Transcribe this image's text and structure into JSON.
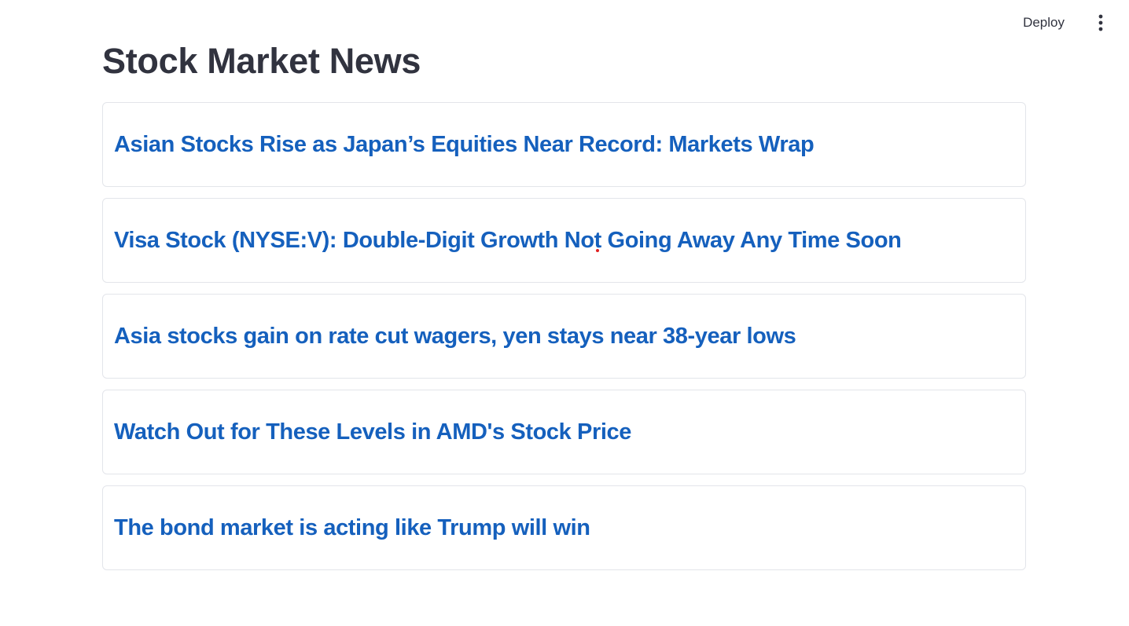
{
  "header": {
    "deploy_label": "Deploy",
    "menu_icon": "vertical-ellipsis-icon"
  },
  "page": {
    "title": "Stock Market News"
  },
  "news": [
    {
      "title": "Asian Stocks Rise as Japan’s Equities Near Record: Markets Wrap"
    },
    {
      "title": "Visa Stock (NYSE:V): Double-Digit Growth Not Going Away Any Time Soon"
    },
    {
      "title": "Asia stocks gain on rate cut wagers, yen stays near 38-year lows"
    },
    {
      "title": "Watch Out for These Levels in AMD's Stock Price"
    },
    {
      "title": "The bond market is acting like Trump will win"
    }
  ],
  "colors": {
    "link": "#1560bd",
    "title": "#31333f",
    "card_border": "#e3e5ea"
  }
}
